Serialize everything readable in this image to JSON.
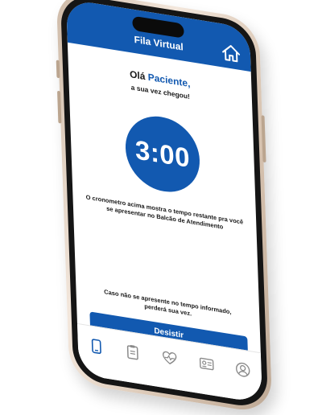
{
  "header": {
    "title": "Fila Virtual",
    "home_icon": "home-icon"
  },
  "greeting": {
    "hello": "Olá",
    "name": "Paciente,",
    "subtitle": "a sua vez chegou!"
  },
  "timer": {
    "value": "3:00"
  },
  "info_text": "O cronometro acima mostra o tempo restante pra você se apresentar no Balcão de Atendimento",
  "warning_text": "Caso não se apresente no tempo informado, perderá sua vez.",
  "cancel_button": "Desistir",
  "tabbar": {
    "items": [
      {
        "icon": "phone-icon",
        "active": true
      },
      {
        "icon": "clipboard-icon",
        "active": false
      },
      {
        "icon": "heart-pulse-icon",
        "active": false
      },
      {
        "icon": "id-card-icon",
        "active": false
      },
      {
        "icon": "user-icon",
        "active": false
      }
    ]
  },
  "colors": {
    "primary": "#1259b0",
    "phone_frame": "#d9c6b3",
    "text": "#1a1a1a"
  }
}
